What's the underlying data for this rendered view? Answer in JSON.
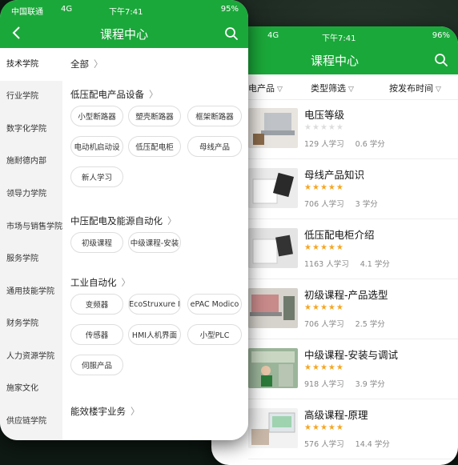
{
  "colors": {
    "brand_green": "#1ba83a",
    "star_gold": "#f5a623",
    "star_empty": "#dddddd"
  },
  "front": {
    "status": {
      "carrier": "中国联通",
      "network": "4G",
      "time": "下午7:41",
      "battery": "95%"
    },
    "title": "课程中心",
    "icons": {
      "back": "chevron-left-icon",
      "search": "search-icon"
    },
    "sidebar": [
      {
        "label": "技术学院",
        "active": true
      },
      {
        "label": "行业学院"
      },
      {
        "label": "数字化学院"
      },
      {
        "label": "施耐德内部"
      },
      {
        "label": "领导力学院"
      },
      {
        "label": "市场与销售学院"
      },
      {
        "label": "服务学院"
      },
      {
        "label": "通用技能学院"
      },
      {
        "label": "财务学院"
      },
      {
        "label": "人力资源学院"
      },
      {
        "label": "施家文化"
      },
      {
        "label": "供应链学院"
      }
    ],
    "all_label": "全部",
    "categories": [
      {
        "title": "低压配电产品设备",
        "chips": [
          "小型断路器",
          "塑壳断路器",
          "框架断路器",
          "电动机启动设",
          "低压配电柜",
          "母线产品",
          "新人学习"
        ]
      },
      {
        "title": "中压配电及能源自动化",
        "chips": [
          "初级课程",
          "中级课程-安装"
        ]
      },
      {
        "title": "工业自动化",
        "chips": [
          "变频器",
          "EcoStruxure I",
          "ePAC Modico",
          "传感器",
          "HMI人机界面",
          "小型PLC",
          "伺服产品"
        ]
      },
      {
        "title": "能效楼宇业务",
        "chips": []
      }
    ]
  },
  "back": {
    "status": {
      "network": "4G",
      "time": "下午7:41",
      "battery": "96%"
    },
    "title": "课程中心",
    "filters": [
      "电产品",
      "类型筛选",
      "按发布时间"
    ],
    "courses": [
      {
        "title": "电压等级",
        "stars": 0,
        "learners": "129 人学习",
        "credits": "0.6 学分"
      },
      {
        "title": "母线产品知识",
        "stars": 5,
        "learners": "706 人学习",
        "credits": "3 学分"
      },
      {
        "title": "低压配电柜介绍",
        "stars": 5,
        "learners": "1163 人学习",
        "credits": "4.1 学分"
      },
      {
        "title": "初级课程-产品选型",
        "stars": 5,
        "learners": "706 人学习",
        "credits": "2.5 学分"
      },
      {
        "title": "中级课程-安装与调试",
        "stars": 5,
        "learners": "918 人学习",
        "credits": "3.9 学分"
      },
      {
        "title": "高级课程-原理",
        "stars": 5,
        "learners": "576 人学习",
        "credits": "14.4 学分"
      }
    ]
  }
}
